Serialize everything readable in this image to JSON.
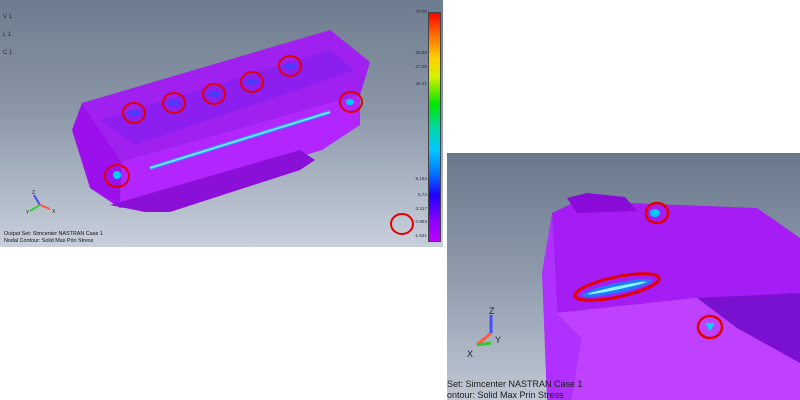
{
  "main_view": {
    "corner_labels": [
      "V 1",
      "L 1",
      "C 1"
    ],
    "status_lines": [
      "Output Set: Simcenter NASTRAN Case 1",
      "Nodal Contour: Solid Max Prin Stress"
    ],
    "legend_ticks": [
      "70.00",
      "",
      "",
      "",
      "29.88",
      "27.05",
      "",
      "25.21",
      "",
      "",
      "",
      "",
      "",
      "",
      "",
      "8.164",
      "5.74",
      "3.317",
      "0.893",
      "-1.531"
    ],
    "triad_labels": {
      "x": "X",
      "y": "Y",
      "z": "Z"
    }
  },
  "zoom_view": {
    "status_lines": [
      "Set: Simcenter NASTRAN Case 1",
      "ontour: Solid Max Prin Stress"
    ],
    "triad_labels": {
      "x": "X",
      "y": "Y",
      "z": "Z"
    }
  },
  "colors": {
    "highlight_circle": "#e00000",
    "part": "#b413ff",
    "hotspot": "#00d0ff"
  }
}
